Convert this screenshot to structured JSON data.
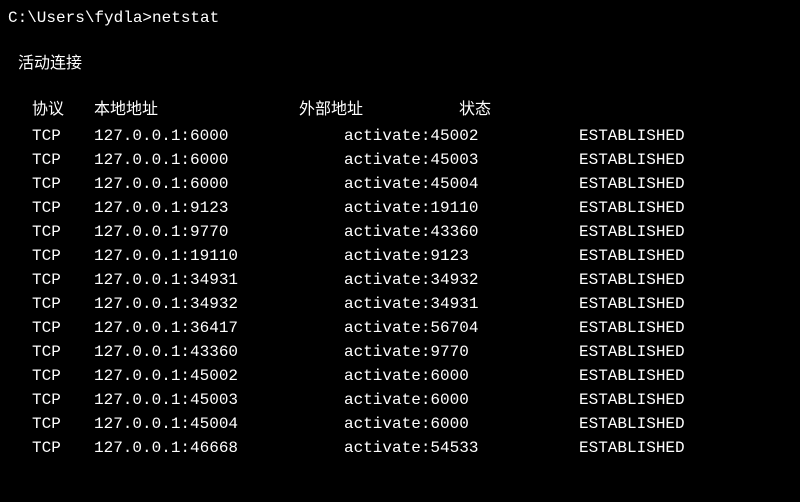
{
  "prompt": "C:\\Users\\fydla>netstat",
  "section_title": "活动连接",
  "headers": {
    "proto": "协议",
    "local": "本地地址",
    "foreign": "外部地址",
    "state": "状态"
  },
  "rows": [
    {
      "proto": "TCP",
      "local": "127.0.0.1:6000",
      "foreign": "activate:45002",
      "state": "ESTABLISHED"
    },
    {
      "proto": "TCP",
      "local": "127.0.0.1:6000",
      "foreign": "activate:45003",
      "state": "ESTABLISHED"
    },
    {
      "proto": "TCP",
      "local": "127.0.0.1:6000",
      "foreign": "activate:45004",
      "state": "ESTABLISHED"
    },
    {
      "proto": "TCP",
      "local": "127.0.0.1:9123",
      "foreign": "activate:19110",
      "state": "ESTABLISHED"
    },
    {
      "proto": "TCP",
      "local": "127.0.0.1:9770",
      "foreign": "activate:43360",
      "state": "ESTABLISHED"
    },
    {
      "proto": "TCP",
      "local": "127.0.0.1:19110",
      "foreign": "activate:9123",
      "state": "ESTABLISHED"
    },
    {
      "proto": "TCP",
      "local": "127.0.0.1:34931",
      "foreign": "activate:34932",
      "state": "ESTABLISHED"
    },
    {
      "proto": "TCP",
      "local": "127.0.0.1:34932",
      "foreign": "activate:34931",
      "state": "ESTABLISHED"
    },
    {
      "proto": "TCP",
      "local": "127.0.0.1:36417",
      "foreign": "activate:56704",
      "state": "ESTABLISHED"
    },
    {
      "proto": "TCP",
      "local": "127.0.0.1:43360",
      "foreign": "activate:9770",
      "state": "ESTABLISHED"
    },
    {
      "proto": "TCP",
      "local": "127.0.0.1:45002",
      "foreign": "activate:6000",
      "state": "ESTABLISHED"
    },
    {
      "proto": "TCP",
      "local": "127.0.0.1:45003",
      "foreign": "activate:6000",
      "state": "ESTABLISHED"
    },
    {
      "proto": "TCP",
      "local": "127.0.0.1:45004",
      "foreign": "activate:6000",
      "state": "ESTABLISHED"
    },
    {
      "proto": "TCP",
      "local": "127.0.0.1:46668",
      "foreign": "activate:54533",
      "state": "ESTABLISHED"
    }
  ]
}
